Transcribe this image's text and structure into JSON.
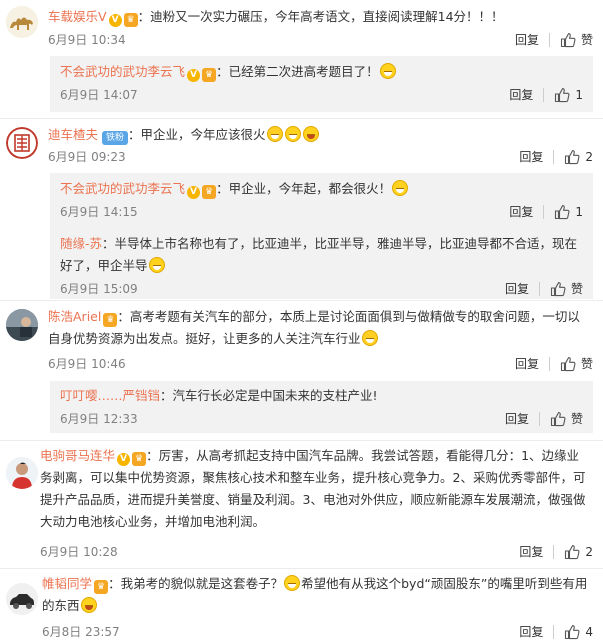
{
  "comments": [
    {
      "user": "车载娱乐V",
      "text": "：迪粉又一次实力碾压，今年高考语文，直接阅读理解14分！！！",
      "time": "6月9日 10:34",
      "reply_label": "回复",
      "likes": "赞",
      "replies": [
        {
          "user": "不会武功的武功李云飞",
          "text": "：已经第二次进高考题目了！",
          "time": "6月9日 14:07",
          "reply_label": "回复",
          "likes": "1"
        }
      ]
    },
    {
      "user": "迪车楂夫",
      "badge": "铁粉",
      "text": "：甲企业，今年应该很火",
      "time": "6月9日 09:23",
      "reply_label": "回复",
      "likes": "2",
      "replies": [
        {
          "user": "不会武功的武功李云飞",
          "text": "：甲企业，今年起，都会很火！",
          "time": "6月9日 14:15",
          "reply_label": "回复",
          "likes": "1"
        },
        {
          "user": "随缘-苏",
          "text": "：半导体上市名称也有了，比亚迪半，比亚半导，雅迪半导，比亚迪导都不合适，现在好了，甲企半导",
          "time": "6月9日 15:09",
          "reply_label": "回复",
          "likes": "赞"
        }
      ]
    },
    {
      "user": "陈浩Ariel",
      "text": "：高考考题有关汽车的部分，本质上是讨论面面俱到与做精做专的取舍问题，一切以自身优势资源为出发点。挺好，让更多的人关注汽车行业",
      "time": "6月9日 10:46",
      "reply_label": "回复",
      "likes": "赞",
      "replies": [
        {
          "user": "叮叮嘤……严铛铛",
          "text": "：汽车行长必定是中国未来的支柱产业!",
          "time": "6月9日 12:33",
          "reply_label": "回复",
          "likes": "赞"
        }
      ]
    },
    {
      "user": "电驹哥马连华",
      "text": "：厉害，从高考抓起支持中国汽车品牌。我尝试答题，看能得几分：1、边缘业务剥离，可以集中优势资源，聚焦核心技术和整车业务，提升核心竞争力。2、采购优秀零部件，可提升产品品质，进而提升美誉度、销量及利润。3、电池对外供应，顺应新能源车发展潮流，做强做大动力电池核心业务，并增加电池利润。",
      "time": "6月9日 10:28",
      "reply_label": "回复",
      "likes": "2",
      "replies": []
    },
    {
      "user": "帷韬同学",
      "text": "：我弟考的貌似就是这套卷子？",
      "text2": "希望他有从我这个byd“顽固股东”的嘴里听到些有用的东西",
      "time": "6月8日 23:57",
      "reply_label": "回复",
      "likes": "4",
      "replies": []
    }
  ]
}
